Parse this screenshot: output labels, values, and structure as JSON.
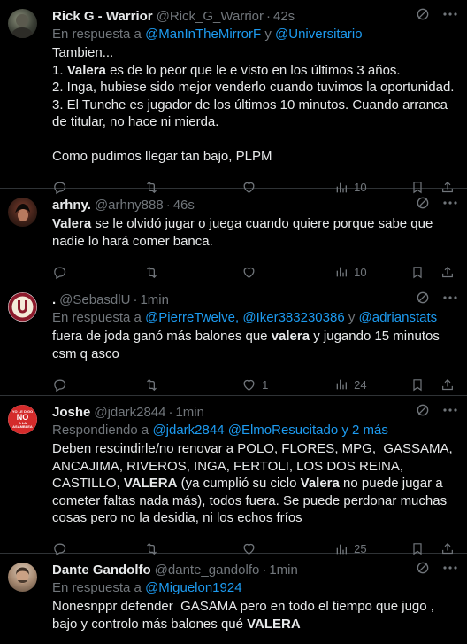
{
  "tweets": [
    {
      "name": "Rick G - Warrior",
      "handle": "@Rick_G_Warrior",
      "time": "42s",
      "reply_prefix": "En respuesta a",
      "reply_links": [
        "@ManInTheMirrorF",
        "@Universitario"
      ],
      "reply_joiner": "y",
      "lines": [
        "Tambien...",
        "1. {Valera} es de lo peor que le e visto en los últimos 3 años.",
        "2. Inga, hubiese sido mejor venderlo cuando tuvimos la oportunidad.",
        "3. El Tunche es jugador de los últimos 10 minutos. Cuando arranca de titular, no hace ni mierda.",
        "",
        "Como pudimos llegar tan bajo, PLPM"
      ],
      "likes": "",
      "views": "10"
    },
    {
      "name": "arhny.",
      "handle": "@arhny888",
      "time": "46s",
      "lines": [
        "{Valera} se le olvidó jugar o juega cuando quiere porque sabe que nadie lo hará comer banca."
      ],
      "likes": "",
      "views": "10"
    },
    {
      "name": ".",
      "handle": "@SebasdlU",
      "time": "1min",
      "reply_prefix": "En respuesta a",
      "reply_links": [
        "@PierreTwelve",
        "@Iker383230386",
        "@adrianstats"
      ],
      "reply_joiner": "y",
      "lines": [
        "fuera de joda ganó más balones que {valera} y jugando 15 minutos csm q asco"
      ],
      "likes": "1",
      "views": "24"
    },
    {
      "name": "Joshe",
      "handle": "@jdark2844",
      "time": "1min",
      "reply_prefix": "Respondiendo a",
      "reply_links": [
        "@jdark2844",
        "@ElmoResucitado y 2 más"
      ],
      "reply_joiner": "",
      "lines": [
        "Deben rescindirle/no renovar a POLO, FLORES, MPG,  GASSAMA, ANCAJIMA, RIVEROS, INGA, FERTOLI, LOS DOS REINA, CASTILLO, {VALERA} (ya cumplió su ciclo {Valera} no puede jugar a cometer faltas nada más), todos fuera. Se puede perdonar muchas cosas pero no la desidia, ni los echos fríos"
      ],
      "likes": "",
      "views": "25",
      "avatar_text": [
        "YO LE DIGO",
        "NO",
        "A LA",
        "ASAMBLEA"
      ]
    },
    {
      "name": "Dante Gandolfo",
      "handle": "@dante_gandolfo",
      "time": "1min",
      "reply_prefix": "En respuesta a",
      "reply_links": [
        "@Miguelon1924"
      ],
      "reply_joiner": "",
      "lines": [
        "Nonesnppr defender  GASAMA pero en todo el tiempo que jugo , bajo y controlo más balones qué {VALERA}"
      ],
      "likes": "",
      "views": ""
    }
  ],
  "colors": {
    "link": "#1d9bf0",
    "muted": "#71767b",
    "text": "#e7e9ea",
    "divider": "#2f3336"
  },
  "icons": [
    "grok-icon",
    "more-icon",
    "reply-icon",
    "retweet-icon",
    "like-icon",
    "views-icon",
    "bookmark-icon",
    "share-icon"
  ]
}
